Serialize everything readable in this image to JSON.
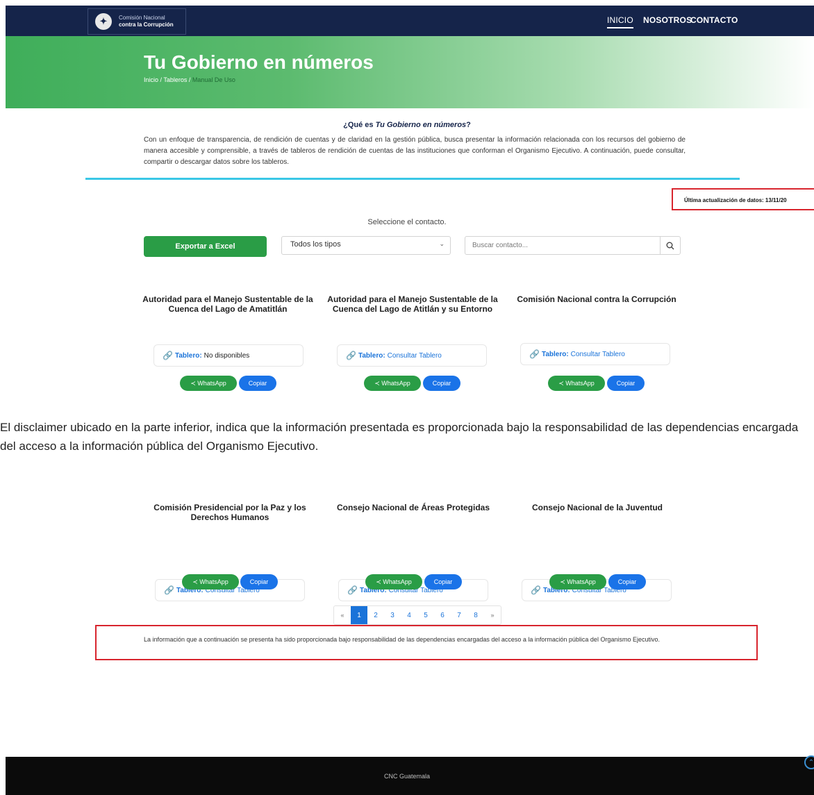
{
  "header": {
    "logo_line1": "Comisión Nacional",
    "logo_line2": "contra la Corrupción",
    "nav": [
      "INICIO",
      "NOSOTROS",
      "CONTACTO"
    ]
  },
  "hero": {
    "title": "Tu Gobierno en números",
    "breadcrumb_a": "Inicio / Tableros / ",
    "breadcrumb_current": "Manual De Uso"
  },
  "about": {
    "question_prefix": "¿Qué es ",
    "question_em": "Tu Gobierno en números",
    "question_suffix": "?",
    "text": "Con un enfoque de transparencia, de rendición de cuentas y de claridad en la gestión pública, busca presentar la información relacionada con los recursos del gobierno de manera accesible y comprensible, a través de tableros de rendición de cuentas de las instituciones que conforman el Organismo Ejecutivo. A continuación, puede consultar, compartir o descargar datos sobre los tableros."
  },
  "update_text": "Última actualización de datos: 13/11/20",
  "filters": {
    "select_label": "Seleccione el contacto.",
    "export_label": "Exportar a Excel",
    "type_select": "Todos los tipos",
    "search_placeholder": "Buscar contacto..."
  },
  "cards_top": [
    {
      "title": "Autoridad para el Manejo Sustentable de la Cuenca del Lago de Amatitlán",
      "tablero_label": "Tablero:",
      "tablero_value": "No disponibles",
      "wa": "WhatsApp",
      "copy": "Copiar"
    },
    {
      "title": "Autoridad para el Manejo Sustentable de la Cuenca del Lago de Atitlán y su Entorno",
      "tablero_label": "Tablero:",
      "tablero_value": "Consultar Tablero",
      "wa": "WhatsApp",
      "copy": "Copiar"
    },
    {
      "title": "Comisión Nacional contra la Corrupción",
      "tablero_label": "Tablero:",
      "tablero_value": "Consultar Tablero",
      "wa": "WhatsApp",
      "copy": "Copiar"
    }
  ],
  "paragraph": "El disclaimer ubicado en la parte inferior, indica que la información presentada es proporcionada bajo la responsabilidad de las dependencias encargada del acceso a la información pública del Organismo Ejecutivo.",
  "cards_bottom": [
    {
      "title": "Comisión Presidencial por la Paz y los Derechos Humanos",
      "tablero_label": "Tablero:",
      "tablero_value": "Consultar Tablero",
      "wa": "WhatsApp",
      "copy": "Copiar"
    },
    {
      "title": "Consejo Nacional de Áreas Protegidas",
      "tablero_label": "Tablero:",
      "tablero_value": "Consultar Tablero",
      "wa": "WhatsApp",
      "copy": "Copiar"
    },
    {
      "title": "Consejo Nacional de la Juventud",
      "tablero_label": "Tablero:",
      "tablero_value": "Consultar Tablero",
      "wa": "WhatsApp",
      "copy": "Copiar"
    }
  ],
  "pagination": {
    "prev": "«",
    "pages": [
      "1",
      "2",
      "3",
      "4",
      "5",
      "6",
      "7",
      "8"
    ],
    "next": "»",
    "active": "1"
  },
  "disclaimer": "La información que a continuación se presenta ha sido proporcionada bajo responsabilidad de las dependencias encargadas del acceso a la información pública del Organismo Ejecutivo.",
  "footer": {
    "text": "CNC Guatemala"
  },
  "colors": {
    "navy": "#15244a",
    "green": "#2a9d46",
    "blue": "#1a73e8",
    "highlight": "#d8252e",
    "cyan": "#3ac7e6"
  }
}
